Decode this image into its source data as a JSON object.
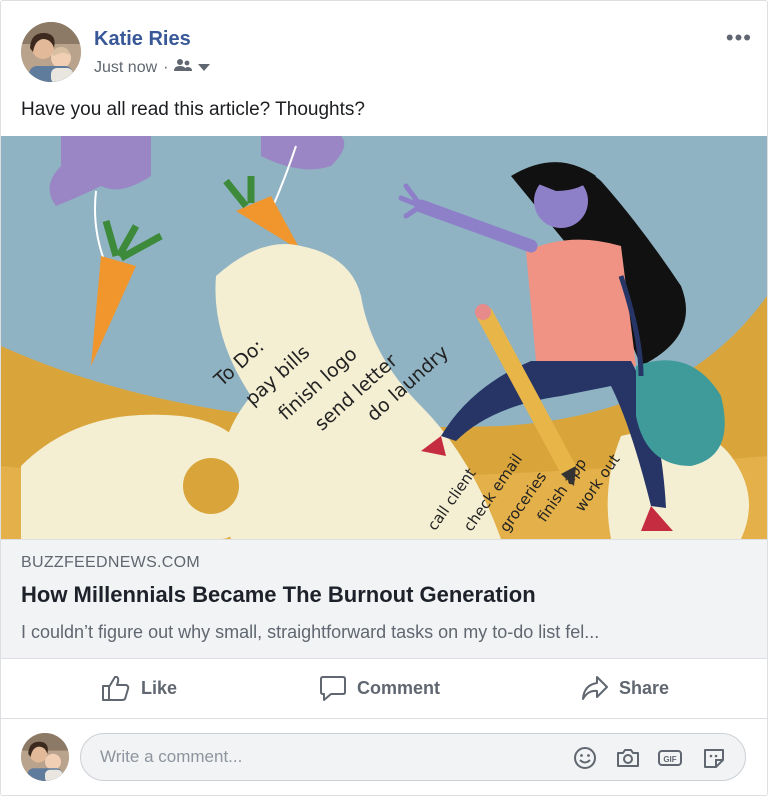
{
  "post": {
    "author": "Katie Ries",
    "time": "Just now",
    "separator": "·",
    "caption": "Have you all read this article? Thoughts?",
    "more_label": "•••",
    "audience_icon": "friends-icon"
  },
  "image": {
    "todo_title": "To Do:",
    "todo_items": [
      "pay bills",
      "finish logo",
      "send letter",
      "do laundry",
      "call client",
      "check email",
      "groceries",
      "finish app",
      "work out"
    ]
  },
  "link": {
    "domain": "BUZZFEEDNEWS.COM",
    "title": "How Millennials Became The Burnout Generation",
    "description": "I couldn’t figure out why small, straightforward tasks on my to-do list fel..."
  },
  "actions": {
    "like": "Like",
    "comment": "Comment",
    "share": "Share"
  },
  "composer": {
    "placeholder": "Write a comment...",
    "gif_label": "GIF"
  },
  "colors": {
    "name_blue": "#385898",
    "sky": "#8fb3c3",
    "ground": "#d9a53a",
    "paper": "#f4eed3",
    "purple": "#8e7fc9"
  }
}
